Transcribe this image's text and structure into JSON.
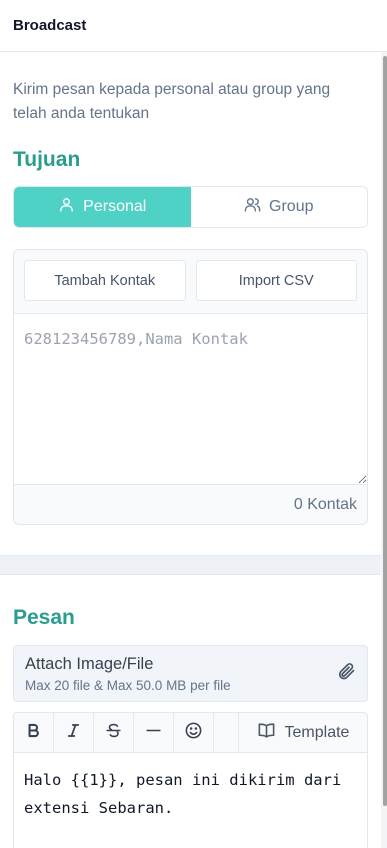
{
  "header": {
    "title": "Broadcast"
  },
  "intro": {
    "description": "Kirim pesan kepada personal atau group yang telah anda tentukan"
  },
  "tujuan": {
    "heading": "Tujuan",
    "options": [
      {
        "label": "Personal",
        "icon": "user-icon",
        "active": true
      },
      {
        "label": "Group",
        "icon": "users-icon",
        "active": false
      }
    ],
    "add_contact_label": "Tambah Kontak",
    "import_csv_label": "Import CSV",
    "contacts_placeholder": "628123456789,Nama Kontak",
    "contact_count": "0 Kontak"
  },
  "pesan": {
    "heading": "Pesan",
    "attach_title": "Attach Image/File",
    "attach_subtitle": "Max 20 file & Max 50.0 MB per file",
    "toolbar": [
      "bold-icon",
      "italic-icon",
      "strikethrough-icon",
      "horizontal-rule-icon",
      "emoji-icon"
    ],
    "template_label": "Template",
    "message_text": "Halo {{1}}, pesan ini dikirim dari extensi Sebaran."
  },
  "colors": {
    "accent": "#4fd1c5",
    "heading": "#2a9d8f"
  }
}
